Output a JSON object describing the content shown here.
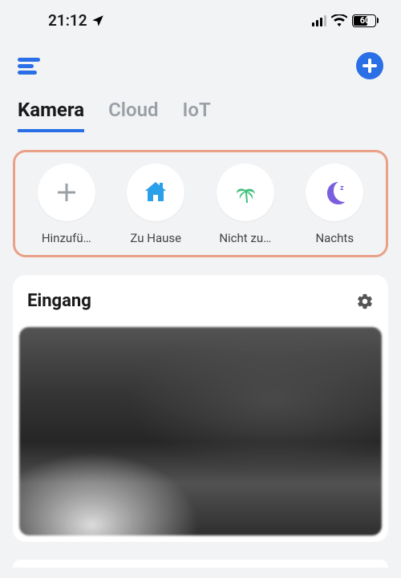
{
  "status": {
    "time": "21:12",
    "battery": "60"
  },
  "tabs": {
    "kamera": "Kamera",
    "cloud": "Cloud",
    "iot": "IoT"
  },
  "modes": {
    "add": "Hinzufü…",
    "home": "Zu Hause",
    "away": "Nicht zu…",
    "night": "Nachts"
  },
  "camera": {
    "title": "Eingang"
  }
}
